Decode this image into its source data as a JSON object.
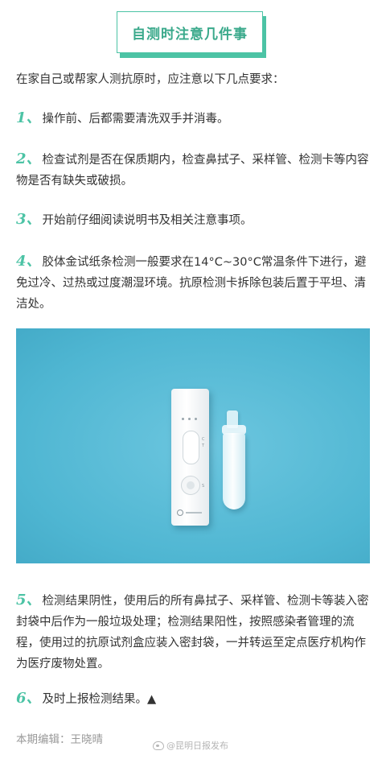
{
  "title": "自测时注意几件事",
  "intro": "在家自己或帮家人测抗原时，应注意以下几点要求：",
  "items": [
    {
      "num": "1、",
      "text": "操作前、后都需要清洗双手并消毒。"
    },
    {
      "num": "2、",
      "text": "检查试剂是否在保质期内，检查鼻拭子、采样管、检测卡等内容物是否有缺失或破损。"
    },
    {
      "num": "3、",
      "text": "开始前仔细阅读说明书及相关注意事项。"
    },
    {
      "num": "4、",
      "text": "胶体金试纸条检测一般要求在14°C~30°C常温条件下进行，避免过冷、过热或过度潮湿环境。抗原检测卡拆除包装后置于平坦、清洁处。"
    },
    {
      "num": "5、",
      "text": "检测结果阴性，使用后的所有鼻拭子、采样管、检测卡等装入密封袋中后作为一般垃圾处理；检测结果阳性，按照感染者管理的流程，使用过的抗原试剂盒应装入密封袋，一并转运至定点医疗机构作为医疗废物处置。"
    },
    {
      "num": "6、",
      "text": "及时上报检测结果。▲"
    }
  ],
  "photo": {
    "cassette_marks": {
      "c": "C",
      "t": "T",
      "s": "S"
    }
  },
  "footer": "本期编辑：王晓晴",
  "watermark": "@昆明日报发布",
  "colors": {
    "accent": "#4cc3a5",
    "title_text": "#3aa98b",
    "photo_bg": "#4fb6d2"
  }
}
